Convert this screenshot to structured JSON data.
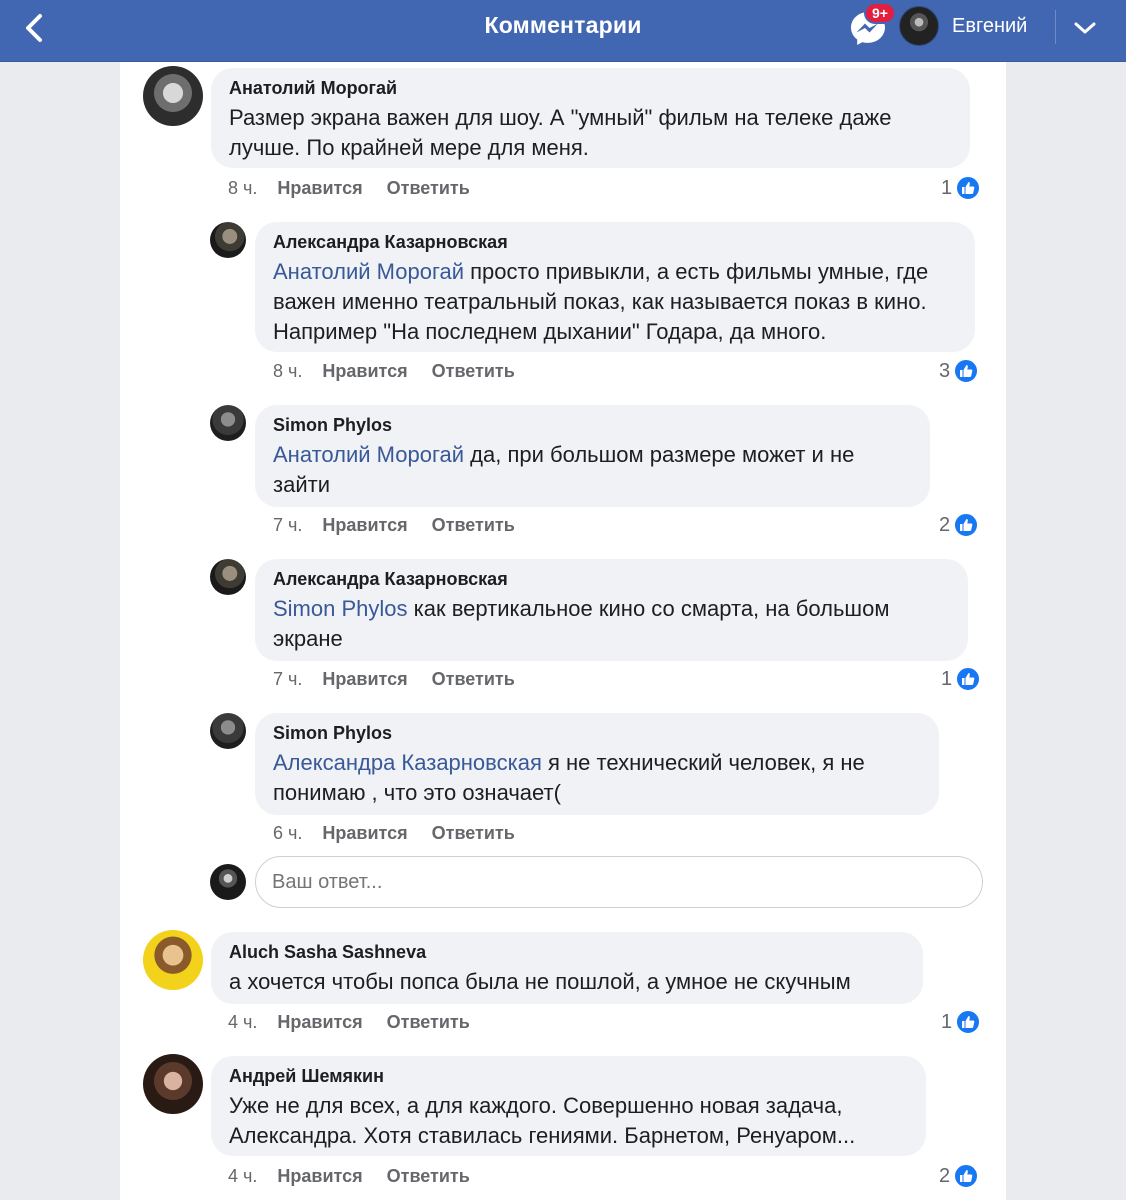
{
  "header": {
    "title": "Комментарии",
    "badge": "9+",
    "user_name": "Евгений"
  },
  "colors": {
    "header_bg": "#4267b2",
    "mention": "#385898",
    "like": "#1877f2",
    "bubble": "#f0f2f5"
  },
  "reply_input": {
    "placeholder": "Ваш ответ..."
  },
  "comments": [
    {
      "author": "Анатолий Морогай",
      "mention": "",
      "text": "Размер экрана важен для шоу. А \"умный\" фильм на телеке даже лучше. По крайней мере для меня.",
      "time": "8 ч.",
      "like_label": "Нравится",
      "reply_label": "Ответить",
      "likes": "1"
    },
    {
      "author": "Александра Казарновская",
      "mention": "Анатолий Морогай",
      "text": "  просто привыкли, а есть  фильмы умные, где важен именно театральный показ, как называется показ в кино. Например \"На последнем дыхании\" Годара, да много.",
      "time": "8 ч.",
      "like_label": "Нравится",
      "reply_label": "Ответить",
      "likes": "3"
    },
    {
      "author": "Simon Phylos",
      "mention": "Анатолий Морогай",
      "text": " да, при большом размере может и не зайти",
      "time": "7 ч.",
      "like_label": "Нравится",
      "reply_label": "Ответить",
      "likes": "2"
    },
    {
      "author": "Александра Казарновская",
      "mention": "Simon Phylos",
      "text": " как вертикальное  кино со смарта, на большом экране",
      "time": "7 ч.",
      "like_label": "Нравится",
      "reply_label": "Ответить",
      "likes": "1"
    },
    {
      "author": "Simon Phylos",
      "mention": "Александра Казарновская",
      "text": " я не технический человек, я не понимаю , что это означает(",
      "time": "6 ч.",
      "like_label": "Нравится",
      "reply_label": "Ответить",
      "likes": ""
    },
    {
      "author": "Aluch Sasha Sashneva",
      "mention": "",
      "text": "а хочется чтобы попса была не пошлой, а умное не скучным",
      "time": "4 ч.",
      "like_label": "Нравится",
      "reply_label": "Ответить",
      "likes": "1"
    },
    {
      "author": "Андрей Шемякин",
      "mention": "",
      "text": "Уже не для всех, а для каждого. Совершенно новая задача, Александра. Хотя ставилась гениями. Барнетом, Ренуаром...",
      "time": "4 ч.",
      "like_label": "Нравится",
      "reply_label": "Ответить",
      "likes": "2"
    }
  ]
}
